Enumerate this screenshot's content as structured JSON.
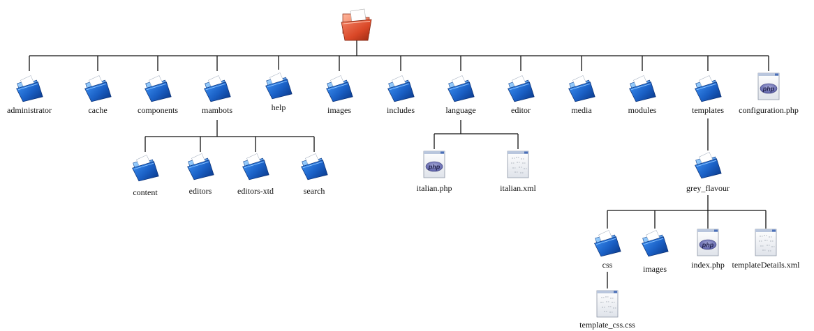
{
  "diagram": {
    "root": {
      "icon": "folder-open-icon"
    },
    "nodes": [
      {
        "id": "administrator",
        "label": "administrator",
        "kind": "folder"
      },
      {
        "id": "cache",
        "label": "cache",
        "kind": "folder"
      },
      {
        "id": "components",
        "label": "components",
        "kind": "folder"
      },
      {
        "id": "mambots",
        "label": "mambots",
        "kind": "folder"
      },
      {
        "id": "help",
        "label": "help",
        "kind": "folder"
      },
      {
        "id": "images",
        "label": "images",
        "kind": "folder"
      },
      {
        "id": "includes",
        "label": "includes",
        "kind": "folder"
      },
      {
        "id": "language",
        "label": "language",
        "kind": "folder"
      },
      {
        "id": "editor",
        "label": "editor",
        "kind": "folder"
      },
      {
        "id": "media",
        "label": "media",
        "kind": "folder"
      },
      {
        "id": "modules",
        "label": "modules",
        "kind": "folder"
      },
      {
        "id": "templates",
        "label": "templates",
        "kind": "folder"
      },
      {
        "id": "configuration",
        "label": "configuration.php",
        "kind": "php"
      },
      {
        "id": "content",
        "label": "content",
        "kind": "folder"
      },
      {
        "id": "editors",
        "label": "editors",
        "kind": "folder"
      },
      {
        "id": "editors-xtd",
        "label": "editors-xtd",
        "kind": "folder"
      },
      {
        "id": "search",
        "label": "search",
        "kind": "folder"
      },
      {
        "id": "italian-php",
        "label": "italian.php",
        "kind": "php"
      },
      {
        "id": "italian-xml",
        "label": "italian.xml",
        "kind": "text"
      },
      {
        "id": "grey-flavour",
        "label": "grey_flavour",
        "kind": "folder"
      },
      {
        "id": "css",
        "label": "css",
        "kind": "folder"
      },
      {
        "id": "images-2",
        "label": "images",
        "kind": "folder"
      },
      {
        "id": "index-php",
        "label": "index.php",
        "kind": "php"
      },
      {
        "id": "template-details",
        "label": "templateDetails.xml",
        "kind": "text"
      },
      {
        "id": "template-css",
        "label": "template_css.css",
        "kind": "text"
      }
    ],
    "icon_badges": {
      "php": "php"
    },
    "icon_names": {
      "folder": "folder-icon",
      "php": "php-file-icon",
      "text": "text-file-icon"
    }
  }
}
